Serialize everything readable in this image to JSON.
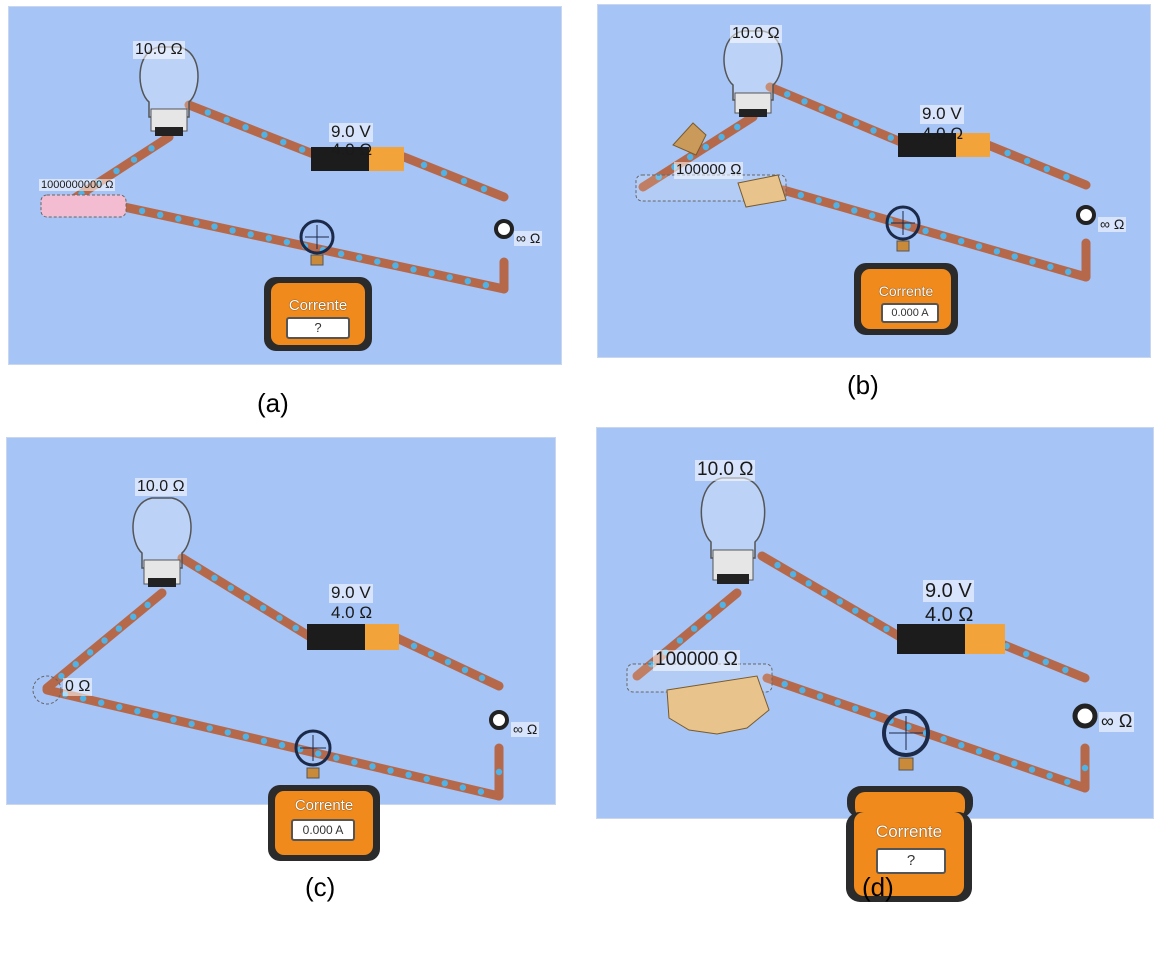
{
  "panels": [
    {
      "caption": "(a)",
      "bulb_label": "10.0 Ω",
      "battery_voltage": "9.0 V",
      "battery_resistance": "4.0 Ω",
      "left_resistor_label": "1000000000 Ω",
      "switch_label": "∞ Ω",
      "meter_title": "Corrente",
      "meter_reading": "?"
    },
    {
      "caption": "(b)",
      "bulb_label": "10.0 Ω",
      "battery_voltage": "9.0 V",
      "battery_resistance": "4.0 Ω",
      "left_resistor_label": "100000 Ω",
      "switch_label": "∞ Ω",
      "meter_title": "Corrente",
      "meter_reading": "0.000 A"
    },
    {
      "caption": "(c)",
      "bulb_label": "10.0 Ω",
      "battery_voltage": "9.0 V",
      "battery_resistance": "4.0 Ω",
      "left_resistor_label": "0 Ω",
      "switch_label": "∞ Ω",
      "meter_title": "Corrente",
      "meter_reading": "0.000 A"
    },
    {
      "caption": "(d)",
      "bulb_label": "10.0 Ω",
      "battery_voltage": "9.0 V",
      "battery_resistance": "4.0 Ω",
      "left_resistor_label": "100000 Ω",
      "switch_label": "∞ Ω",
      "meter_title": "Corrente",
      "meter_reading": "?"
    }
  ],
  "colors": {
    "background": "#a6c4f5",
    "wire_copper": "#b5694a",
    "electron": "#4fb3e8",
    "meter_body": "#f08a1c",
    "battery_dark": "#1c1c1c",
    "battery_orange": "#f2a33a"
  }
}
